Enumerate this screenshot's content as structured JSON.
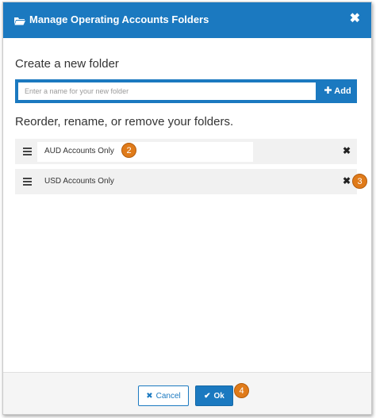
{
  "dialog": {
    "title": "Manage Operating Accounts Folders",
    "close_icon": "close-icon",
    "header_icon": "folder-open-icon"
  },
  "create": {
    "heading": "Create a new folder",
    "input_placeholder": "Enter a name for your new folder",
    "input_value": "",
    "add_label": "Add",
    "add_icon": "plus-icon"
  },
  "manage": {
    "heading": "Reorder, rename, or remove your folders.",
    "folders": [
      {
        "name": "AUD Accounts Only",
        "editing": true
      },
      {
        "name": "USD Accounts Only",
        "editing": false
      }
    ]
  },
  "footer": {
    "cancel_label": "Cancel",
    "ok_label": "Ok"
  },
  "callouts": [
    "2",
    "3",
    "4"
  ],
  "colors": {
    "primary": "#1b79c0",
    "callout": "#e07b1a",
    "row_bg": "#f1f1f1"
  }
}
